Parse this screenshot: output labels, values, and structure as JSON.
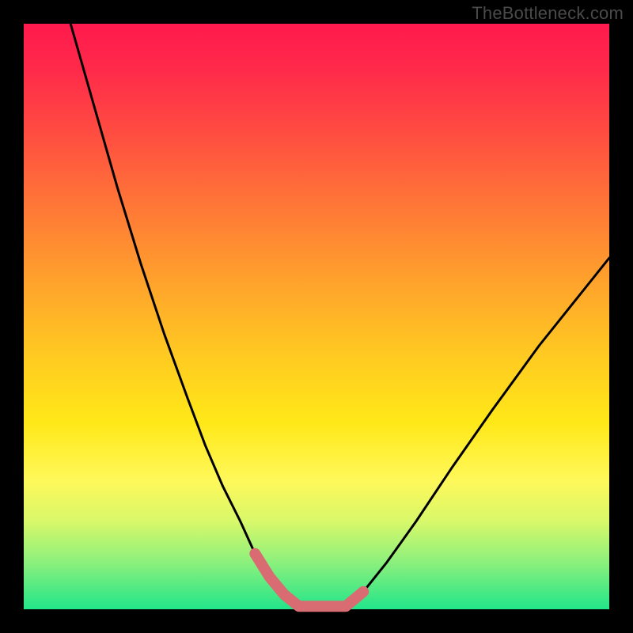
{
  "watermark": "TheBottleneck.com",
  "chart_data": {
    "type": "line",
    "title": "",
    "xlabel": "",
    "ylabel": "",
    "xlim": [
      0,
      1
    ],
    "ylim": [
      0,
      1
    ],
    "series": [
      {
        "name": "black-curve",
        "x": [
          0.08,
          0.12,
          0.16,
          0.2,
          0.24,
          0.28,
          0.31,
          0.34,
          0.37,
          0.395,
          0.42,
          0.445,
          0.47,
          0.55,
          0.58,
          0.62,
          0.67,
          0.73,
          0.8,
          0.88,
          0.96,
          1.0
        ],
        "y": [
          1.0,
          0.86,
          0.72,
          0.59,
          0.47,
          0.36,
          0.28,
          0.21,
          0.15,
          0.095,
          0.055,
          0.025,
          0.005,
          0.005,
          0.03,
          0.08,
          0.15,
          0.24,
          0.34,
          0.45,
          0.55,
          0.6
        ]
      },
      {
        "name": "pink-highlight",
        "x": [
          0.395,
          0.42,
          0.445,
          0.47,
          0.51,
          0.55,
          0.58
        ],
        "y": [
          0.095,
          0.055,
          0.025,
          0.005,
          0.005,
          0.005,
          0.03
        ]
      }
    ],
    "colors": {
      "black_curve": "#000000",
      "pink_highlight": "#d96b73",
      "gradient_top": "#ff1a4d",
      "gradient_mid": "#ffe818",
      "gradient_bottom": "#22e58a"
    }
  }
}
